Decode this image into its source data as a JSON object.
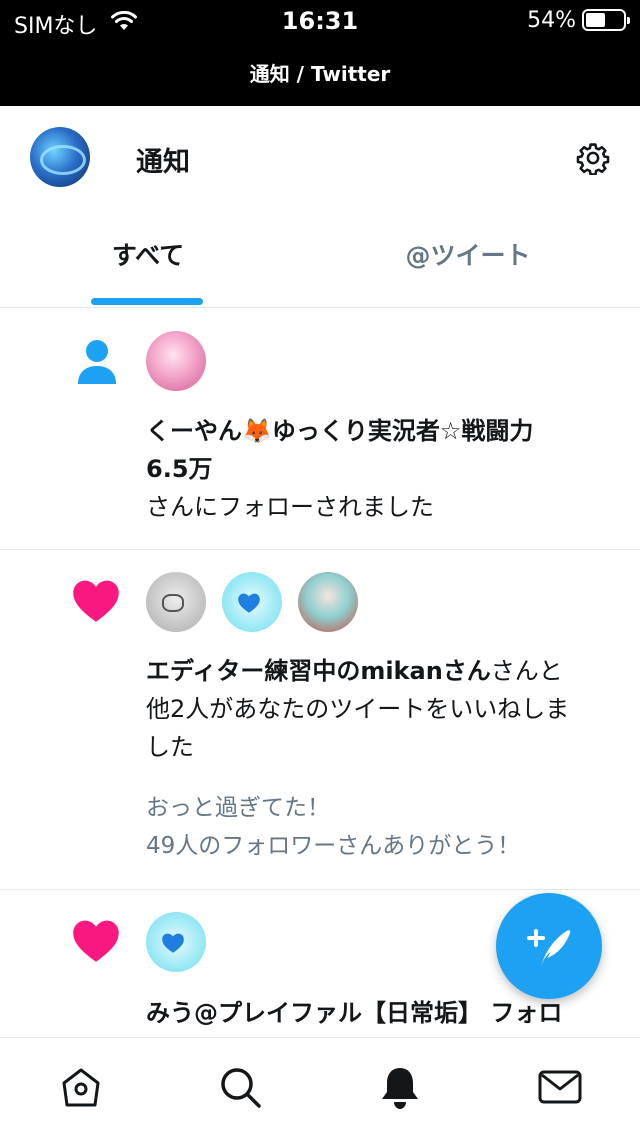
{
  "status_bar": {
    "carrier": "SIMなし",
    "time": "16:31",
    "battery_percent": "54%",
    "battery_level": 0.54
  },
  "browser": {
    "title": "通知 / Twitter"
  },
  "header": {
    "title": "通知"
  },
  "tabs": [
    {
      "label": "すべて",
      "selected": true
    },
    {
      "label": "@ツイート",
      "selected": false
    }
  ],
  "notifications": [
    {
      "type": "follow",
      "icon": "person-icon",
      "name_line1": "くーやん🦊ゆっくり実況者☆戦闘力",
      "name_line2": "6.5万",
      "action": "さんにフォローされました"
    },
    {
      "type": "like",
      "icon": "heart-icon",
      "name": "エディター練習中のmikanさん",
      "action_line1": "さんと",
      "action_line2": "他2人があなたのツイートをいいねしま",
      "action_line3": "した",
      "tweet_line1": "おっと過ぎてた！",
      "tweet_line2": "49人のフォロワーさんありがとう！"
    },
    {
      "type": "like",
      "icon": "heart-icon",
      "text": "みう@プレイファル【日常垢】 フォロ"
    }
  ],
  "colors": {
    "accent": "#1da1f2",
    "like": "#f91880",
    "text": "#14171a",
    "secondary_text": "#657786",
    "divider": "#e1e8ed"
  },
  "tab_bar": [
    "home-icon",
    "search-icon",
    "notifications-icon",
    "messages-icon"
  ]
}
